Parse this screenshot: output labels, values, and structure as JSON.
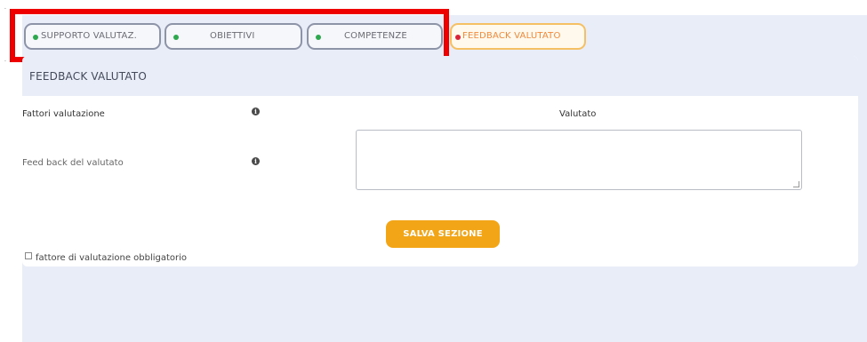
{
  "tabs": [
    {
      "label": "SUPPORTO VALUTAZ.",
      "status_color": "#2ea84e"
    },
    {
      "label": "OBIETTIVI",
      "status_color": "#2ea84e"
    },
    {
      "label": "COMPETENZE",
      "status_color": "#2ea84e"
    },
    {
      "label": "FEEDBACK VALUTATO",
      "status_color": "#d8243a"
    }
  ],
  "section": {
    "title": "FEEDBACK VALUTATO",
    "factors_label": "Fattori valutazione",
    "column_header": "Valutato",
    "feedback_label": "Feed back del valutato",
    "feedback_value": "",
    "save_button": "SALVA SEZIONE",
    "mandatory_note": "fattore di valutazione obbligatorio"
  },
  "colors": {
    "accent": "#f2a517",
    "highlight": "#ee0000",
    "page_background": "#e9edf8"
  },
  "icons": {
    "info": "info-icon"
  }
}
